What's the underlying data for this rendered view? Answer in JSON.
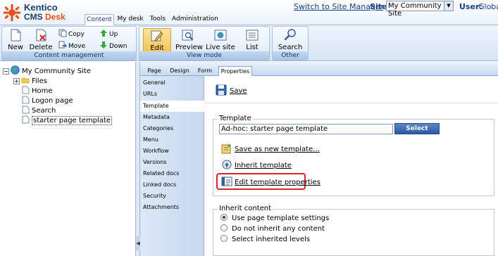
{
  "brand": {
    "line1": "Kentico",
    "line2_a": "CMS ",
    "line2_b": "Desk"
  },
  "header": {
    "switch_link": "Switch to Site Manager",
    "site_label": "Site:",
    "site_value": "My Community Site",
    "user_label": "User:",
    "user_value": "Global"
  },
  "main_tabs": [
    {
      "label": "Content",
      "active": true
    },
    {
      "label": "My desk"
    },
    {
      "label": "Tools"
    },
    {
      "label": "Administration"
    }
  ],
  "ribbon": {
    "content_management": {
      "title": "Content management",
      "new": "New",
      "delete": "Delete",
      "copy": "Copy",
      "move": "Move",
      "up": "Up",
      "down": "Down"
    },
    "view_mode": {
      "title": "View mode",
      "edit": "Edit",
      "preview": "Preview",
      "live_site": "Live site",
      "list": "List"
    },
    "other": {
      "title": "Other",
      "search": "Search"
    }
  },
  "tree": {
    "root": "My Community Site",
    "items": [
      "Files",
      "Home",
      "Logon page",
      "Search",
      "starter page template"
    ]
  },
  "content_tabs": [
    "Page",
    "Design",
    "Form",
    "Properties"
  ],
  "property_tabs": [
    "General",
    "URLs",
    "Template",
    "Metadata",
    "Categories",
    "Menu",
    "Workflow",
    "Versions",
    "Related docs",
    "Linked docs",
    "Security",
    "Attachments"
  ],
  "panel": {
    "save": "Save",
    "template_legend": "Template",
    "template_value": "Ad-hoc: starter page template",
    "select_button": "Select",
    "save_as_new": "Save as new template...",
    "inherit_template": "Inherit template",
    "edit_template_properties": "Edit template properties",
    "inherit_legend": "Inherit content",
    "inherit_options": [
      "Use page template settings",
      "Do not inherit any content",
      "Select inherited levels"
    ]
  },
  "colors": {
    "accent": "#1a3f85",
    "highlight": "#d9262b",
    "active_button": "#f8c35a"
  }
}
